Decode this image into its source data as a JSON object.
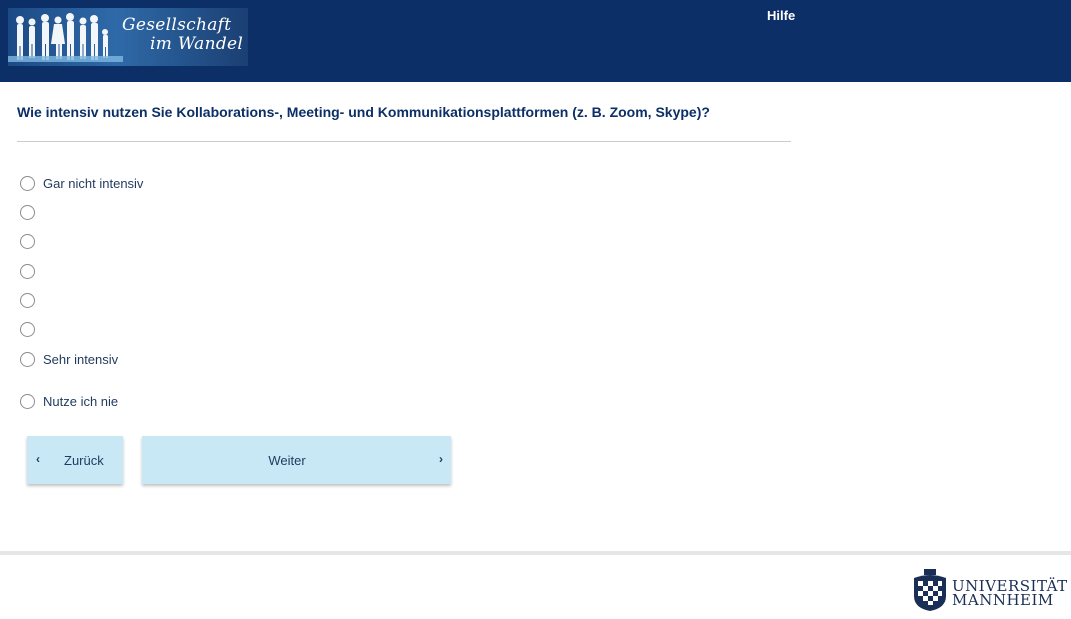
{
  "header": {
    "logo_line1": "Gesellschaft",
    "logo_line2": "im Wandel",
    "help": "Hilfe"
  },
  "question": "Wie intensiv nutzen Sie Kollaborations-, Meeting- und Kommunikationsplattformen (z. B. Zoom, Skype)?",
  "options": [
    {
      "label": "Gar nicht intensiv"
    },
    {
      "label": ""
    },
    {
      "label": ""
    },
    {
      "label": ""
    },
    {
      "label": ""
    },
    {
      "label": ""
    },
    {
      "label": "Sehr intensiv"
    },
    {
      "label": "Nutze ich nie"
    }
  ],
  "nav": {
    "back_label": "Zurück",
    "next_label": "Weiter",
    "back_chevron": "‹",
    "next_chevron": "›"
  },
  "footer": {
    "uni_line1": "UNIVERSITÄT",
    "uni_line2": "MANNHEIM"
  },
  "colors": {
    "header_bg": "#0b2f66",
    "button_bg": "#c8e8f5",
    "question_text": "#0b2f66"
  }
}
